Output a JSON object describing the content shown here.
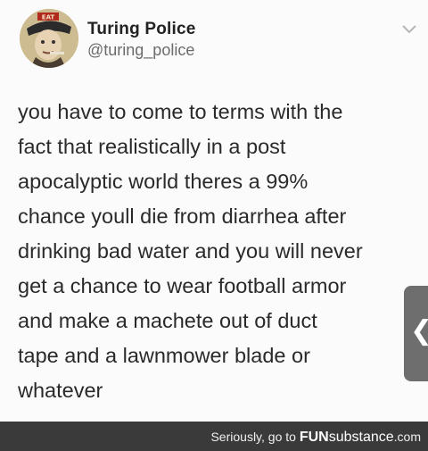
{
  "tweet": {
    "display_name": "Turing Police",
    "handle": "@turing_police",
    "avatar_badge": "EAT",
    "lines": [
      "you have to come to terms with the",
      "fact that realistically in a post",
      "apocalyptic world theres a 99%",
      "chance youll die from diarrhea after",
      "drinking bad water and you will never",
      "get a chance to wear football armor",
      "and make a machete out of duct",
      "tape and a lawnmower blade or",
      "whatever"
    ]
  },
  "side_tab": {
    "glyph": "❮"
  },
  "footer": {
    "prefix": "Seriously, go to ",
    "brand_fun": "FUN",
    "brand_sub": "substance",
    "brand_suffix": ".com"
  },
  "colors": {
    "footer_bg": "#3a3a3a",
    "text": "#2a2a2a",
    "handle": "#6b6b6b"
  },
  "icons": {
    "chevron": "chevron-down-icon",
    "side": "chevron-left-icon"
  }
}
